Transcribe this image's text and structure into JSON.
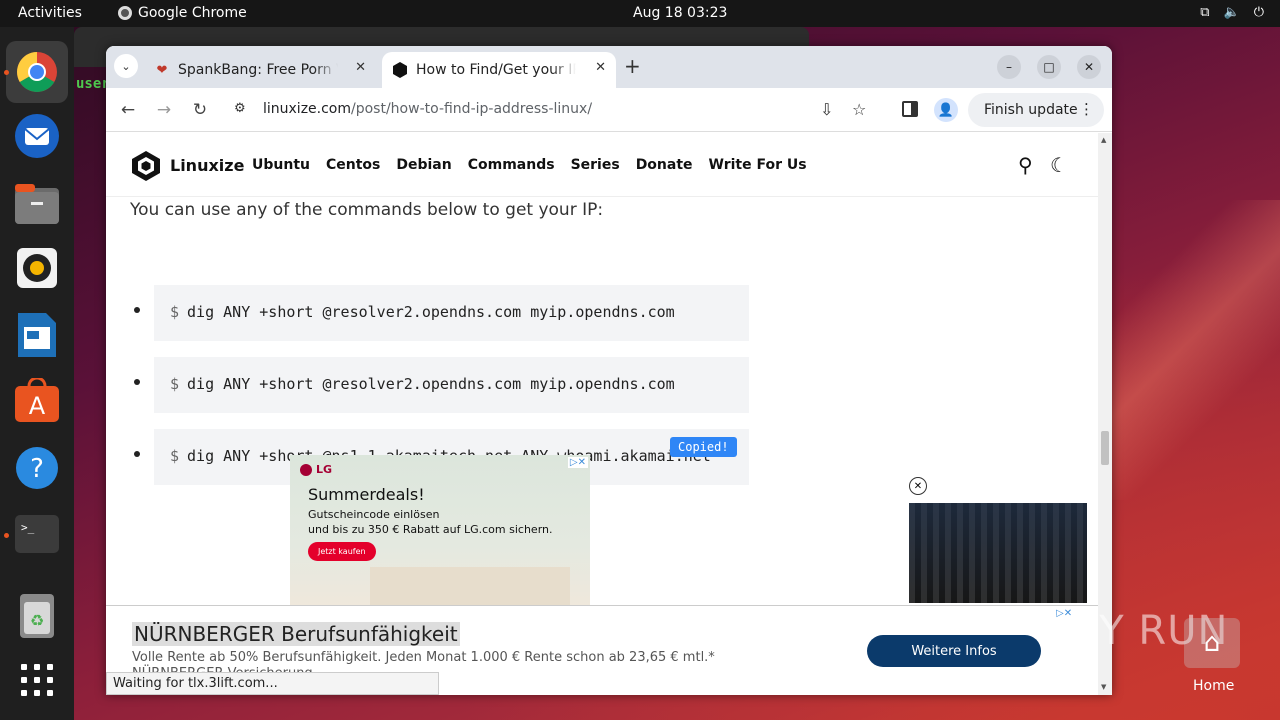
{
  "topbar": {
    "activities": "Activities",
    "app_name": "Google Chrome",
    "clock": "Aug 18  03:23"
  },
  "terminal_behind": {
    "text": "user"
  },
  "chrome": {
    "tabs": [
      {
        "title": "SpankBang: Free Porn Videos",
        "favicon": "heart-icon"
      },
      {
        "title": "How to Find/Get your IP Address",
        "favicon": "linuxize-icon",
        "active": true
      }
    ],
    "url_domain": "linuxize.com",
    "url_path": "/post/how-to-find-ip-address-linux/",
    "finish_update": "Finish update"
  },
  "page": {
    "logo": "Linuxize",
    "nav": [
      "Ubuntu",
      "Centos",
      "Debian",
      "Commands",
      "Series",
      "Donate",
      "Write For Us"
    ],
    "intro": "You can use any of the commands below to get your IP:",
    "prompt": "$",
    "commands": [
      "dig ANY +short @resolver2.opendns.com myip.opendns.com",
      "dig ANY +short @resolver2.opendns.com myip.opendns.com",
      "dig ANY +short @ns1-1.akamaitech.net ANY whoami.akamai.net"
    ],
    "copied_label": "Copied!",
    "ad_lg": {
      "brand": "LG",
      "title": "Summerdeals!",
      "line1": "Gutscheincode einlösen",
      "line2": "und bis zu 350 € Rabatt auf LG.com sichern.",
      "cta": "Jetzt kaufen"
    },
    "bottom_ad": {
      "title": "NÜRNBERGER Berufsunfähigkeit",
      "text": "Volle Rente ab 50% Berufsunfähigkeit. Jeden Monat 1.000 € Rente schon ab 23,65 € mtl.* NÜRNBERGER Versicherung",
      "button": "Weitere Infos"
    },
    "status": "Waiting for tlx.3lift.com..."
  },
  "watermark": "ANY RUN",
  "home_label": "Home"
}
